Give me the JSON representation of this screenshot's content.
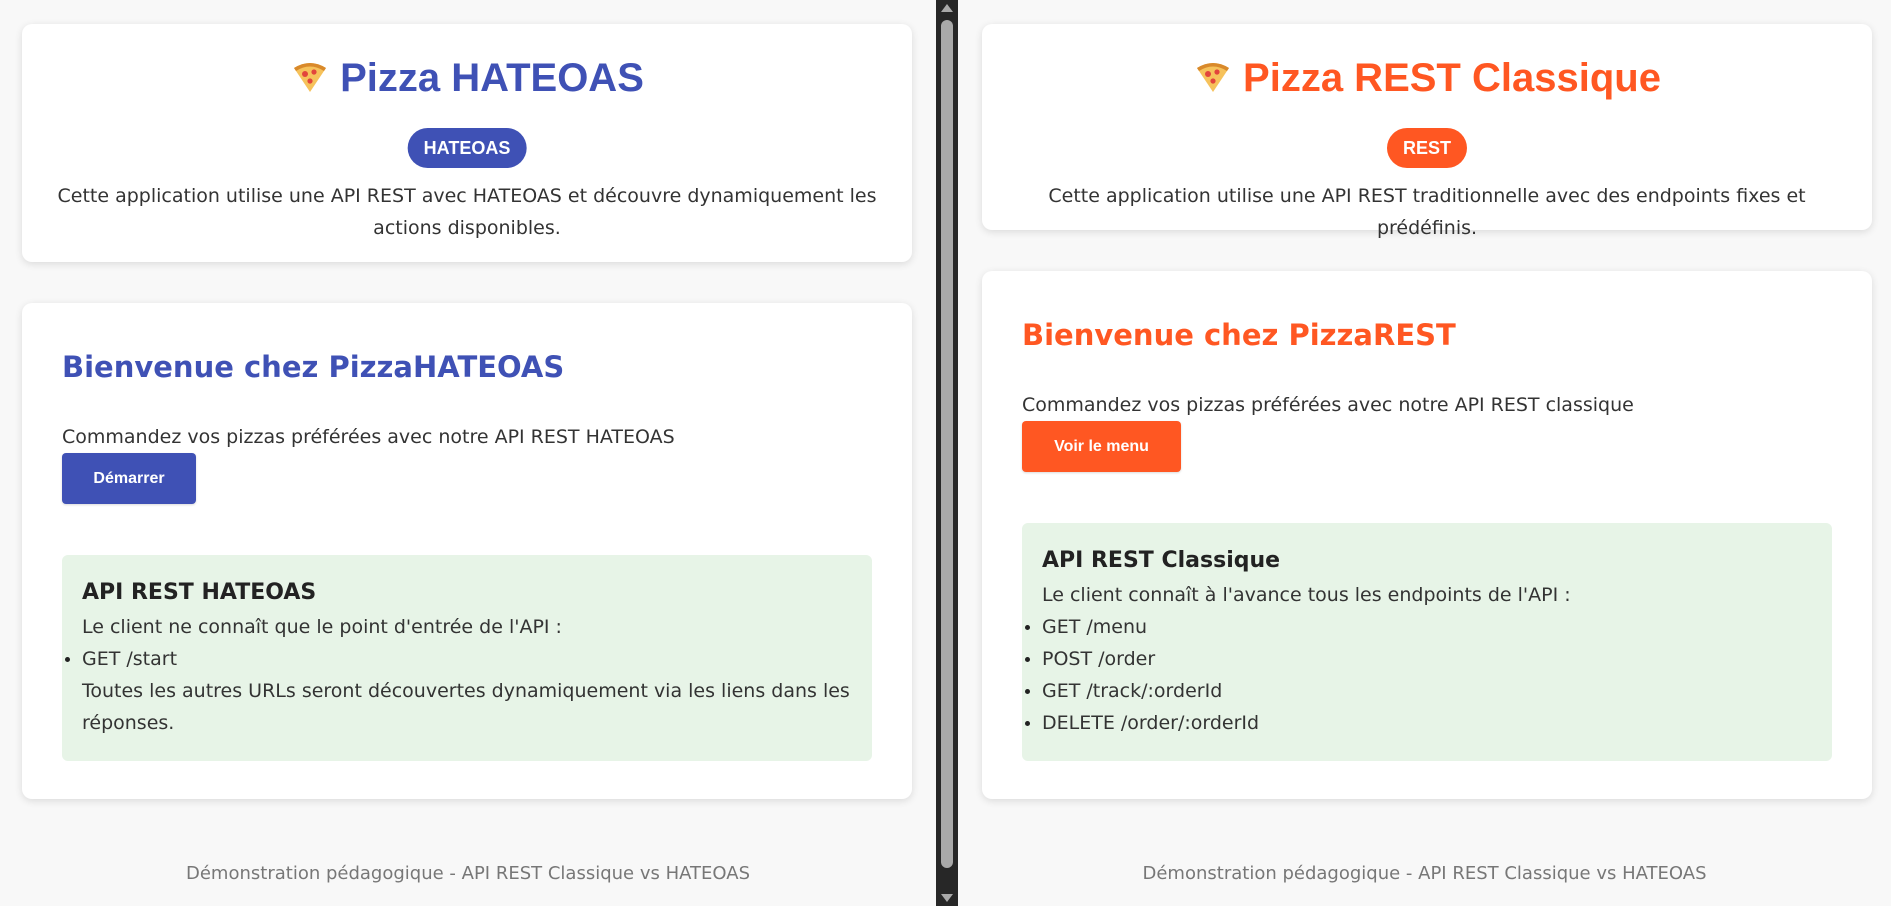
{
  "colors": {
    "hateoas_accent": "#3f51b5",
    "rest_accent": "#ff5722",
    "info_bg": "#e7f4e7"
  },
  "left": {
    "title": "Pizza HATEOAS",
    "title_icon": "pizza-slice-icon",
    "badge": "HATEOAS",
    "description": "Cette application utilise une API REST avec HATEOAS et découvre dynamiquement les actions disponibles.",
    "welcome_heading": "Bienvenue chez PizzaHATEOAS",
    "lead": "Commandez vos pizzas préférées avec notre API REST HATEOAS",
    "button_label": "Démarrer",
    "info": {
      "heading": "API REST HATEOAS",
      "intro": "Le client ne connaît que le point d'entrée de l'API :",
      "endpoints": [
        "GET /start"
      ],
      "note": "Toutes les autres URLs seront découvertes dynamiquement via les liens dans les réponses."
    },
    "footer": "Démonstration pédagogique - API REST Classique vs HATEOAS"
  },
  "right": {
    "title": "Pizza REST Classique",
    "title_icon": "pizza-slice-icon",
    "badge": "REST",
    "description": "Cette application utilise une API REST traditionnelle avec des endpoints fixes et prédéfinis.",
    "welcome_heading": "Bienvenue chez PizzaREST",
    "lead": "Commandez vos pizzas préférées avec notre API REST classique",
    "button_label": "Voir le menu",
    "info": {
      "heading": "API REST Classique",
      "intro": "Le client connaît à l'avance tous les endpoints de l'API :",
      "endpoints": [
        "GET /menu",
        "POST /order",
        "GET /track/:orderId",
        "DELETE /order/:orderId"
      ]
    },
    "footer": "Démonstration pédagogique - API REST Classique vs HATEOAS"
  }
}
